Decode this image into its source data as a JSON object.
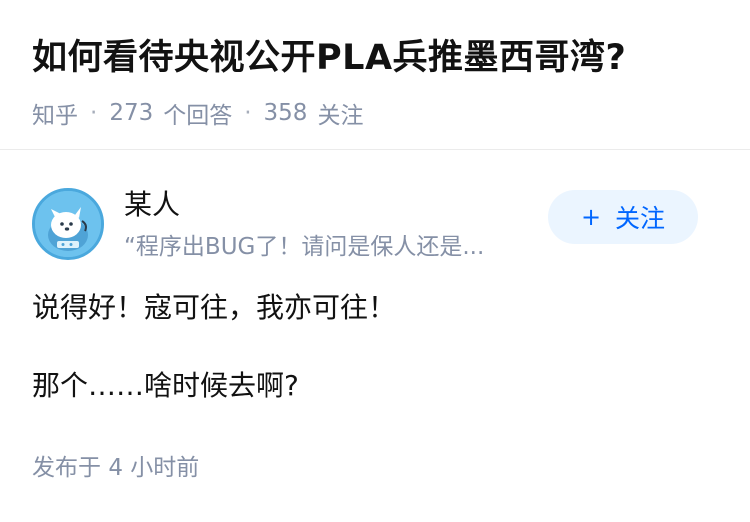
{
  "question": {
    "title": "如何看待央视公开PLA兵推墨西哥湾?",
    "source": "知乎",
    "answers_count": "273",
    "answers_label": "个回答",
    "followers_count": "358",
    "followers_label": "关注",
    "separator": "·"
  },
  "answer": {
    "author_name": "某人",
    "author_bio": "“程序出BUG了！请问是保人还是...",
    "follow_icon": "plus-icon",
    "follow_plus": "+",
    "follow_label": "关注",
    "paragraphs": [
      "说得好！寇可往，我亦可往！",
      "那个……啥时候去啊?"
    ],
    "published_label": "发布于",
    "published_time": "4 小时前"
  },
  "colors": {
    "accent": "#0066ff",
    "accent_bg": "#ebf5ff",
    "meta": "#8590a6",
    "avatar_bg": "#6dc2ee"
  }
}
